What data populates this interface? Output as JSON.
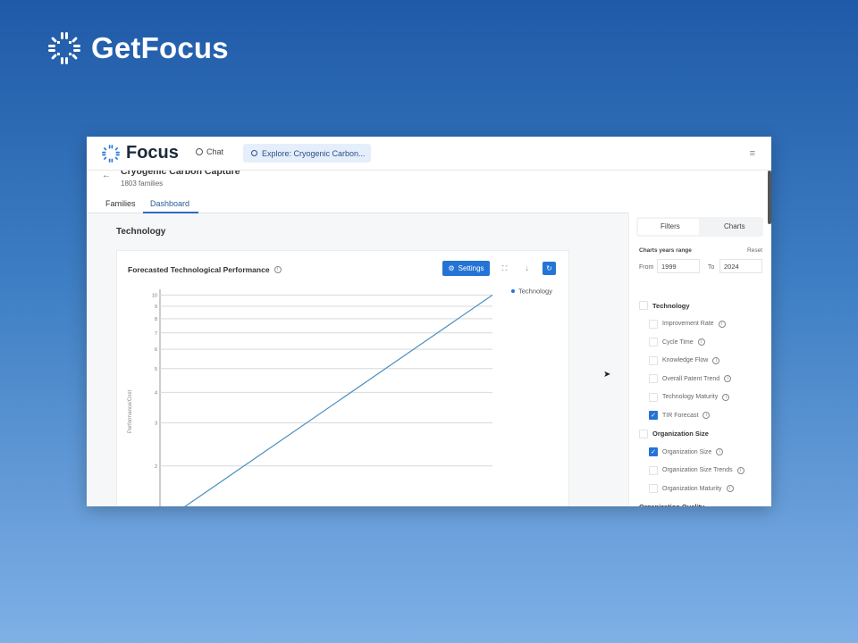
{
  "brand": {
    "name": "GetFocus"
  },
  "app": {
    "name": "Focus",
    "chat_label": "Chat",
    "explore_label": "Explore: Cryogenic Carbon..."
  },
  "project": {
    "title": "Cryogenic Carbon Capture",
    "subtitle": "1803 families"
  },
  "tabs": [
    {
      "label": "Families"
    },
    {
      "label": "Dashboard"
    }
  ],
  "section": {
    "title": "Technology"
  },
  "card": {
    "title": "Forecasted Technological Performance",
    "settings_label": "Settings"
  },
  "sidebar": {
    "tabs": [
      {
        "label": "Filters"
      },
      {
        "label": "Charts"
      }
    ],
    "range_label": "Charts years range",
    "reset_label": "Reset",
    "from_label": "From",
    "from_value": "1999",
    "to_label": "To",
    "to_value": "2024",
    "groups": [
      {
        "label": "Technology",
        "items": [
          {
            "label": "Improvement Rate",
            "checked": false
          },
          {
            "label": "Cycle Time",
            "checked": false
          },
          {
            "label": "Knowledge Flow",
            "checked": false
          },
          {
            "label": "Overall Patent Trend",
            "checked": false
          },
          {
            "label": "Technology Maturity",
            "checked": false
          },
          {
            "label": "TIR Forecast",
            "checked": true
          }
        ]
      },
      {
        "label": "Organization Size",
        "items": [
          {
            "label": "Organization Size",
            "checked": true
          },
          {
            "label": "Organization Size Trends",
            "checked": false
          },
          {
            "label": "Organization Maturity",
            "checked": false
          }
        ]
      },
      {
        "label": "Organization Quality",
        "items": []
      }
    ]
  },
  "colors": {
    "accent": "#2474d6",
    "line": "#4a8fc0"
  },
  "chart_data": {
    "type": "line",
    "title": "Forecasted Technological Performance",
    "ylabel": "Performance/Cost",
    "yscale": "log",
    "y_ticks": [
      2,
      3,
      4,
      5,
      6,
      7,
      8,
      9,
      10
    ],
    "series": [
      {
        "name": "Technology",
        "points_y": [
          1.35,
          10
        ]
      }
    ],
    "legend": "top-right",
    "grid": true
  }
}
